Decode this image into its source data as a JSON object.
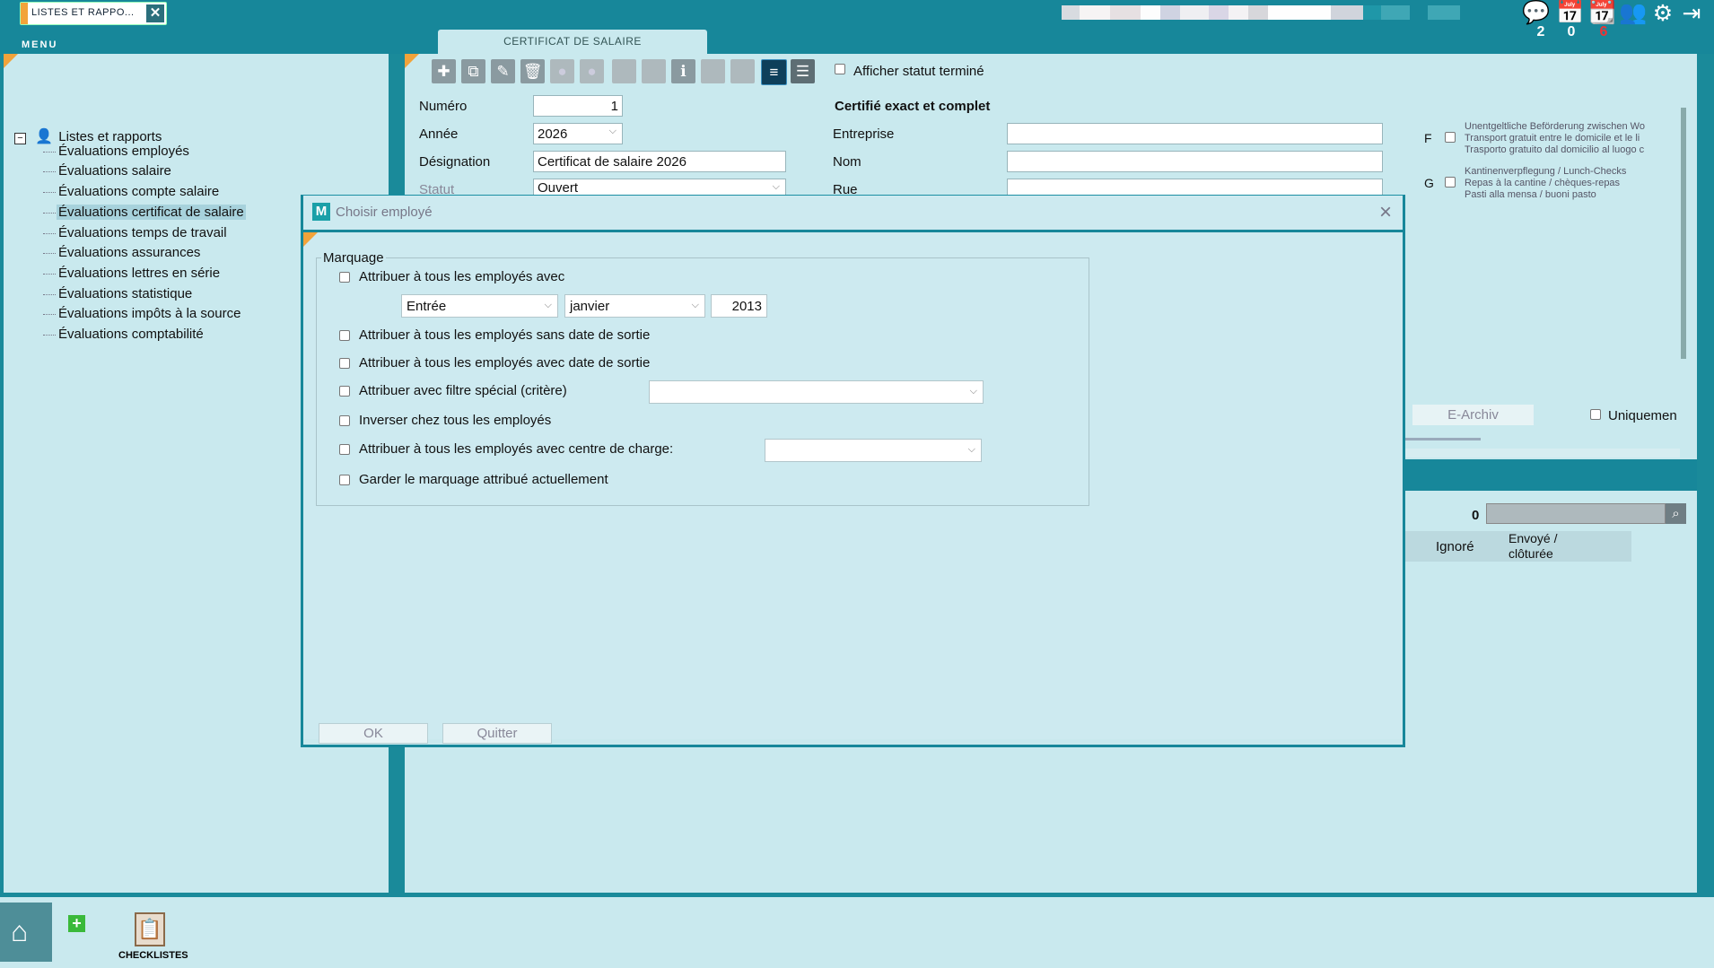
{
  "app_tab": {
    "label": "LISTES ET RAPPO...",
    "close_icon": "close-icon"
  },
  "menu": {
    "title": "MENU"
  },
  "top_counters": [
    {
      "icon": "chat-icon",
      "count": "2"
    },
    {
      "icon": "calendar-icon",
      "count": "0"
    },
    {
      "icon": "calendar-alert-icon",
      "count": "6"
    }
  ],
  "tree": {
    "root": "Listes et rapports",
    "items": [
      "Évaluations employés",
      "Évaluations salaire",
      "Évaluations compte salaire",
      "Évaluations certificat de salaire",
      "Évaluations temps de travail",
      "Évaluations assurances",
      "Évaluations lettres en série",
      "Évaluations statistique",
      "Évaluations impôts à la source",
      "Évaluations comptabilité"
    ],
    "selected_index": 3
  },
  "main": {
    "tab_label": "CERTIFICAT DE SALAIRE",
    "show_finished_label": "Afficher statut terminé",
    "numero_label": "Numéro",
    "numero_value": "1",
    "annee_label": "Année",
    "annee_value": "2026",
    "designation_label": "Désignation",
    "designation_value": "Certificat de salaire 2026",
    "statut_label": "Statut",
    "statut_value": "Ouvert",
    "certified_label": "Certifié exact et complet",
    "entreprise_label": "Entreprise",
    "nom_label": "Nom",
    "rue_label": "Rue",
    "f_letter": "F",
    "f_text": [
      "Unentgeltliche Beförderung zwischen Wo",
      "Transport gratuit entre le domicile et le li",
      "Trasporto gratuito dal domicilio al luogo c"
    ],
    "g_letter": "G",
    "g_text": [
      "Kantinenverpflegung / Lunch-Checks",
      "Repas à la cantine / chèques-repas",
      "Pasti alla mensa / buoni pasto"
    ],
    "earchiv_label": "E-Archiv",
    "uniquement_label": "Uniquemen",
    "count_value": "0",
    "col_ignore": "Ignoré",
    "col_sent": "Envoyé /",
    "col_sent2": "clôturée"
  },
  "dialog": {
    "title": "Choisir employé",
    "group_label": "Marquage",
    "opt1": "Attribuer à tous les employés avec",
    "sel_type": "Entrée",
    "sel_month": "janvier",
    "year_value": "2013",
    "opt2": "Attribuer à tous les employés sans date de sortie",
    "opt3": "Attribuer à tous les employés avec date de sortie",
    "opt4": "Attribuer avec filtre spécial (critère)",
    "opt5": "Inverser chez tous les employés",
    "opt6": "Attribuer à tous les employés avec centre de charge:",
    "opt7": "Garder le marquage attribué actuellement",
    "ok_label": "OK",
    "quit_label": "Quitter"
  },
  "bottom": {
    "checklist_label": "CHECKLISTES"
  }
}
